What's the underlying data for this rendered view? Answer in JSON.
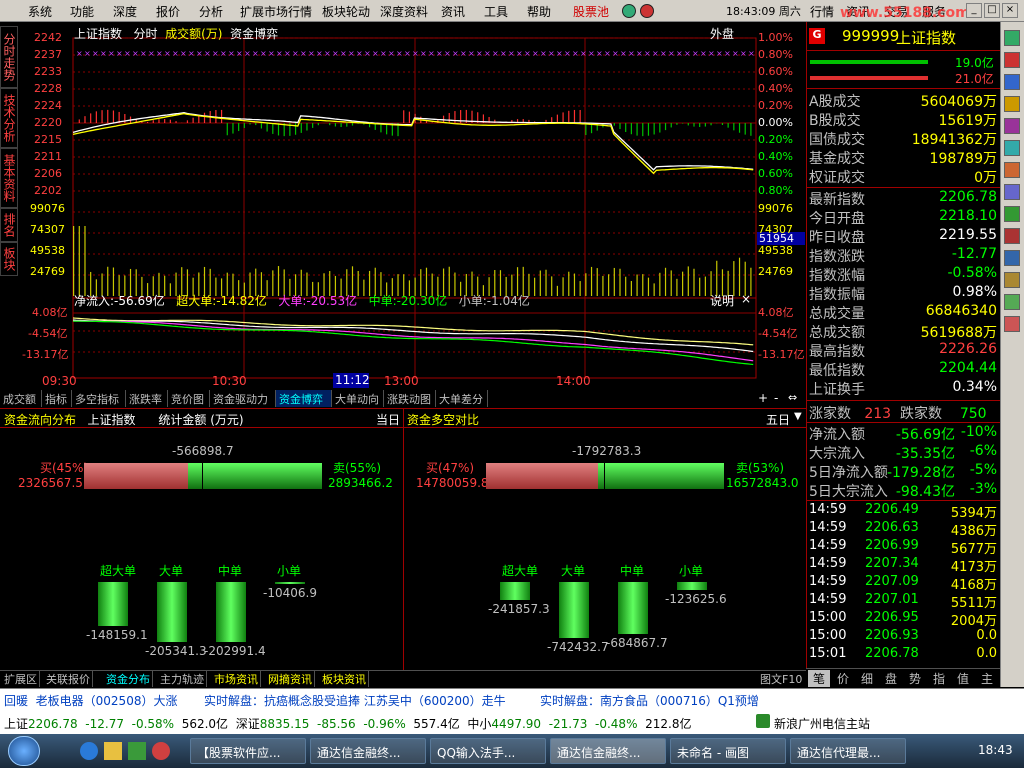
{
  "menu": [
    "系统",
    "功能",
    "深度",
    "报价",
    "分析",
    "扩展市场行情",
    "板块轮动",
    "深度资料",
    "资讯",
    "工具",
    "帮助"
  ],
  "stock_pool": "股票池",
  "clock": "18:43:09 周六",
  "menu_right": [
    "行情",
    "资讯",
    "交易",
    "服务"
  ],
  "watermark": "www.55188.com",
  "vtabs": [
    "分时走势",
    "技术分析",
    "基本资料",
    "排名",
    "板块"
  ],
  "chart_header": {
    "name": "上证指数",
    "mode": "分时",
    "vol_label": "成交额(万)",
    "game": "资金博弈",
    "outer": "外盘"
  },
  "price_ticks_left": [
    "2242",
    "2237",
    "2233",
    "2228",
    "2224",
    "2220",
    "2215",
    "2211",
    "2206",
    "2202"
  ],
  "pct_ticks_right": [
    "1.00%",
    "0.80%",
    "0.60%",
    "0.40%",
    "0.20%",
    "0.00%",
    "0.20%",
    "0.40%",
    "0.60%",
    "0.80%"
  ],
  "vol_ticks_left": [
    "99076",
    "74307",
    "49538",
    "24769"
  ],
  "vol_ticks_right": [
    "99076",
    "74307",
    "49538",
    "24769"
  ],
  "vol_highlight": "51954",
  "flow_header": {
    "net": "净流入:-56.69亿",
    "super": "超大单:-14.82亿",
    "large": "大单:-20.53亿",
    "mid": "中单:-20.30亿",
    "small": "小单:-1.04亿",
    "explain": "说明",
    "close": "×"
  },
  "flow_ticks": [
    "4.08亿",
    "-4.54亿",
    "-13.17亿"
  ],
  "time_ticks": [
    "09:30",
    "10:30",
    "11:12",
    "13:00",
    "14:00"
  ],
  "bottom_tabs": [
    "成交额",
    "指标",
    "多空指标",
    "涨跌率",
    "竞价图",
    "资金驱动力",
    "资金博弈",
    "大单动向",
    "涨跌动图",
    "大单差分"
  ],
  "panel_left": {
    "title": "资金流向分布",
    "name": "上证指数",
    "stat": "统计金额 (万元)",
    "period": "当日",
    "net": "-566898.7",
    "buy_label": "买(45%)",
    "buy_val": "2326567.5",
    "sell_label": "卖(55%)",
    "sell_val": "2893466.2",
    "bars": [
      {
        "label": "超大单",
        "val": "-148159.1"
      },
      {
        "label": "大单",
        "val": "-205341.3"
      },
      {
        "label": "中单",
        "val": "-202991.4"
      },
      {
        "label": "小单",
        "val": "-10406.9"
      }
    ]
  },
  "panel_right": {
    "title": "资金多空对比",
    "period": "五日",
    "net": "-1792783.3",
    "buy_label": "买(47%)",
    "buy_val": "14780059.8",
    "sell_label": "卖(53%)",
    "sell_val": "16572843.0",
    "bars": [
      {
        "label": "超大单",
        "val": "-241857.3"
      },
      {
        "label": "大单",
        "val": "-742432.7"
      },
      {
        "label": "中单",
        "val": "-684867.7"
      },
      {
        "label": "小单",
        "val": "-123625.6"
      }
    ]
  },
  "bottom_bar": [
    "扩展区",
    "关联报价",
    "资金分布",
    "主力轨迹",
    "市场资讯",
    "网摘资讯",
    "板块资讯"
  ],
  "right": {
    "code": "999999",
    "name": "上证指数",
    "g": "G",
    "bar1": "19.0亿",
    "bar2": "21.0亿",
    "rows1": [
      {
        "l": "A股成交",
        "v": "5604069万"
      },
      {
        "l": "B股成交",
        "v": "15619万"
      },
      {
        "l": "国债成交",
        "v": "18941362万"
      },
      {
        "l": "基金成交",
        "v": "198789万"
      },
      {
        "l": "权证成交",
        "v": "0万"
      }
    ],
    "rows2": [
      {
        "l": "最新指数",
        "v": "2206.78",
        "c": "grn"
      },
      {
        "l": "今日开盘",
        "v": "2218.10",
        "c": "grn"
      },
      {
        "l": "昨日收盘",
        "v": "2219.55",
        "c": "wht"
      },
      {
        "l": "指数涨跌",
        "v": "-12.77",
        "c": "grn"
      },
      {
        "l": "指数涨幅",
        "v": "-0.58%",
        "c": "grn"
      },
      {
        "l": "指数振幅",
        "v": "0.98%",
        "c": "wht"
      },
      {
        "l": "总成交量",
        "v": "66846340",
        "c": "yel"
      },
      {
        "l": "总成交额",
        "v": "5619688万",
        "c": "yel"
      },
      {
        "l": "最高指数",
        "v": "2226.26",
        "c": "red"
      },
      {
        "l": "最低指数",
        "v": "2204.44",
        "c": "grn"
      },
      {
        "l": "上证换手",
        "v": "0.34%",
        "c": "wht"
      }
    ],
    "up_label": "涨家数",
    "up": "213",
    "down_label": "跌家数",
    "down": "750",
    "flows": [
      {
        "l": "净流入额",
        "v": "-56.69亿",
        "p": "-10%"
      },
      {
        "l": "大宗流入",
        "v": "-35.35亿",
        "p": "-6%"
      },
      {
        "l": "5日净流入额",
        "v": "-179.28亿",
        "p": "-5%"
      },
      {
        "l": "5日大宗流入",
        "v": "-98.43亿",
        "p": "-3%"
      }
    ],
    "ticks": [
      {
        "t": "14:59",
        "p": "2206.49",
        "v": "5394万"
      },
      {
        "t": "14:59",
        "p": "2206.63",
        "v": "4386万"
      },
      {
        "t": "14:59",
        "p": "2206.99",
        "v": "5677万"
      },
      {
        "t": "14:59",
        "p": "2207.34",
        "v": "4173万"
      },
      {
        "t": "14:59",
        "p": "2207.09",
        "v": "4168万"
      },
      {
        "t": "14:59",
        "p": "2207.01",
        "v": "5511万"
      },
      {
        "t": "15:00",
        "p": "2206.95",
        "v": "2004万"
      },
      {
        "t": "15:00",
        "p": "2206.93",
        "v": "0.0"
      },
      {
        "t": "15:01",
        "p": "2206.78",
        "v": "0.0"
      }
    ],
    "tabs": [
      "笔",
      "价",
      "细",
      "盘",
      "势",
      "指",
      "值",
      "主"
    ],
    "f10": "图文F10"
  },
  "ticker1": [
    {
      "a": "回暖",
      "b": "老板电器（002508）大涨"
    },
    {
      "a": "实时解盘：",
      "b": "抗癌概念股受追捧 江苏吴中（600200）走牛"
    },
    {
      "a": "实时解盘：",
      "b": "南方食品（000716）Q1预增"
    }
  ],
  "ticker2": {
    "sh": "上证",
    "sh_p": "2206.78",
    "sh_c": "-12.77",
    "sh_r": "-0.58%",
    "sh_v": "562.0亿",
    "sz": "深证",
    "sz_p": "8835.15",
    "sz_c": "-85.56",
    "sz_r": "-0.96%",
    "sz_v": "557.4亿",
    "zx": "中小",
    "zx_p": "4497.90",
    "zx_c": "-21.73",
    "zx_r": "-0.48%",
    "zx_v": "212.8亿",
    "isp": "新浪广州电信主站"
  },
  "taskbar": [
    "【股票软件应...",
    "通达信金融终...",
    "QQ输入法手...",
    "通达信金融终...",
    "未命名 - 画图",
    "通达信代理最..."
  ],
  "tray_time": "18:43"
}
